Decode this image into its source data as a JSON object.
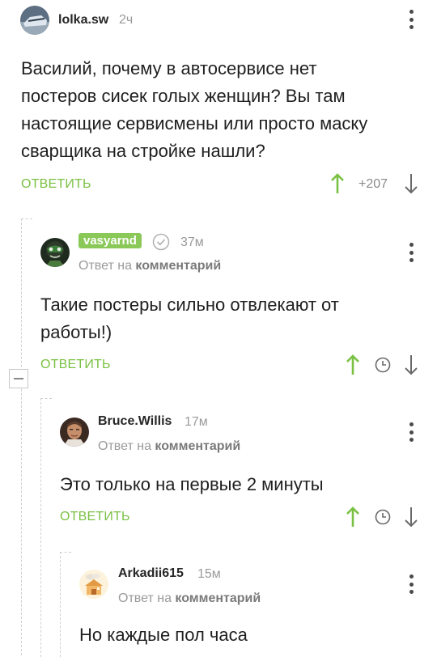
{
  "comments": [
    {
      "user": "lolka.sw",
      "time": "2ч",
      "text_lines": [
        "Василий, почему в автосервисе нет",
        "постеров сисек голых женщин? Вы там",
        "настоящие сервисмены или просто маску",
        "сварщика на стройке нашли?"
      ],
      "reply_label": "ОТВЕТИТЬ",
      "score": "+207",
      "avatar_icon": "car-avatar-icon"
    },
    {
      "user": "vasyarnd",
      "time": "37м",
      "reply_to_prefix": "Ответ на",
      "reply_to_target": "комментарий",
      "text_lines": [
        "Такие постеры сильно отвлекают от",
        "работы!)"
      ],
      "reply_label": "ОТВЕТИТЬ",
      "avatar_icon": "mask-avatar-icon"
    },
    {
      "user": "Bruce.Willis",
      "time": "17м",
      "reply_to_prefix": "Ответ на",
      "reply_to_target": "комментарий",
      "text_lines": [
        "Это только на первые 2 минуты"
      ],
      "reply_label": "ОТВЕТИТЬ",
      "avatar_icon": "portrait-avatar-icon"
    },
    {
      "user": "Arkadii615",
      "time": "15м",
      "reply_to_prefix": "Ответ на",
      "reply_to_target": "комментарий",
      "text_lines": [
        "Но каждые пол часа"
      ],
      "avatar_icon": "house-avatar-icon"
    }
  ],
  "colors": {
    "accent": "#7ac143",
    "badge": "#8ac858",
    "muted": "#9a9a9a"
  }
}
